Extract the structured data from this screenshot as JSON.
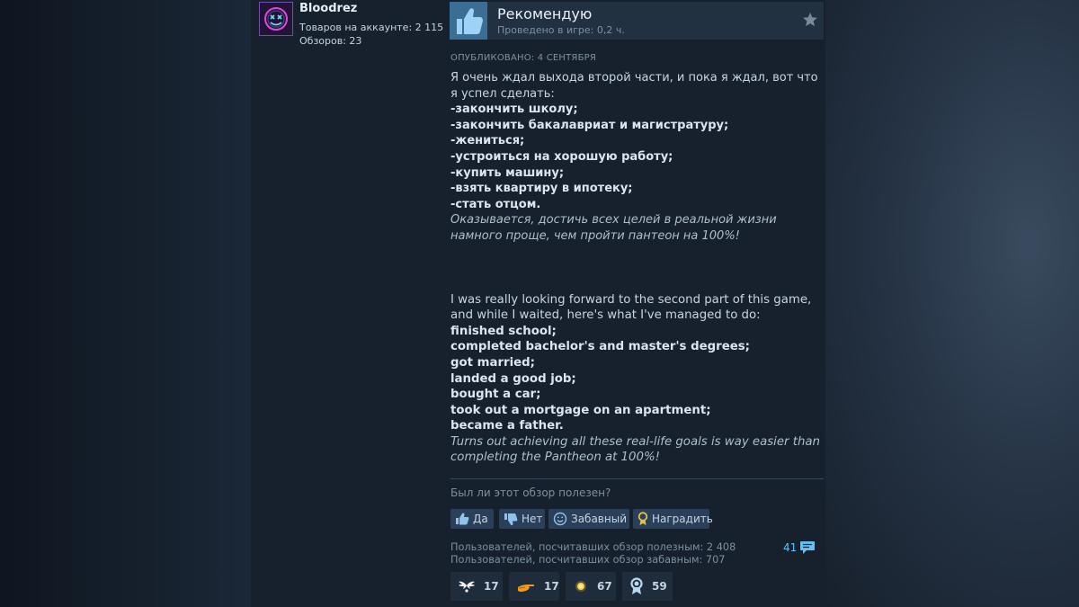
{
  "author": {
    "name": "Bloodrez",
    "products_label": "Товаров на аккаунте: 2 115",
    "reviews_label": "Обзоров: 23"
  },
  "review": {
    "verdict": "Рекомендую",
    "hours": "Проведено в игре: 0,2 ч.",
    "posted": "ОПУБЛИКОВАНО: 4 СЕНТЯБРЯ",
    "ru_intro": "Я очень ждал выхода второй части, и пока я ждал, вот что я успел сделать:",
    "ru_items": [
      "-закончить школу;",
      "-закончить бакалавриат и магистратуру;",
      "-жениться;",
      "-устроиться на хорошую работу;",
      "-купить машину;",
      "-взять квартиру в ипотеку;",
      "-стать отцом."
    ],
    "ru_outro": "Оказывается, достичь всех целей в реальной жизни намного проще, чем пройти пантеон на 100%!",
    "en_intro": "I was really looking forward to the second part of this game, and while I waited, here's what I've managed to do:",
    "en_items": [
      "finished school;",
      "completed bachelor's and master's degrees;",
      "got married;",
      "landed a good job;",
      "bought a car;",
      "took out a mortgage on an apartment;",
      "became a father."
    ],
    "en_outro": "Turns out achieving all these real-life goals is way easier than completing the Pantheon at 100%!"
  },
  "feedback": {
    "question": "Был ли этот обзор полезен?",
    "buttons": {
      "yes": "Да",
      "no": "Нет",
      "funny": "Забавный",
      "award": "Наградить"
    },
    "helpful_count": "Пользователей, посчитавших обзор полезным: 2 408",
    "funny_count": "Пользователей, посчитавших обзор забавным: 707",
    "comments": "41"
  },
  "awards": [
    {
      "icon": "wings-award-icon",
      "count": "17"
    },
    {
      "icon": "hand-award-icon",
      "count": "17"
    },
    {
      "icon": "sun-award-icon",
      "count": "67"
    },
    {
      "icon": "medal-award-icon",
      "count": "59"
    }
  ],
  "colors": {
    "background": "#1b2838",
    "panel": "#17212e",
    "header": "#213142",
    "thumb": "#3a6e95",
    "button": "#2a3f5a",
    "link": "#66c0f4"
  }
}
